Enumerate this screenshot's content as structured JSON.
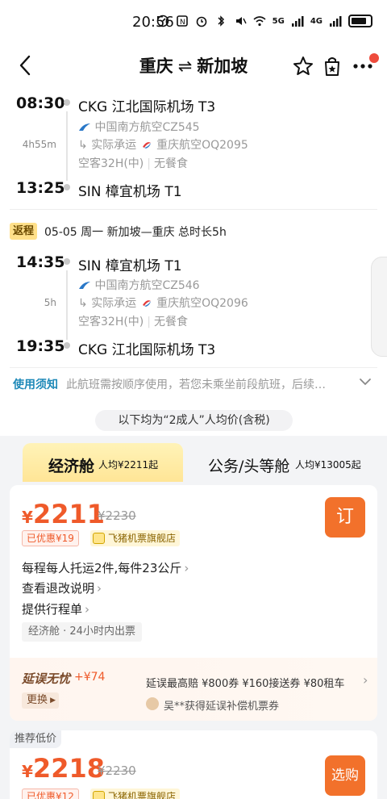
{
  "status_bar": {
    "time": "20:56",
    "network_5g": "5G",
    "network_4g": "4G"
  },
  "header": {
    "origin": "重庆",
    "arrow": "⇌",
    "destination": "新加坡"
  },
  "outbound": {
    "dep_time": "08:30",
    "dep_airport": "CKG 江北国际机场 T3",
    "duration": "4h55m",
    "airline": "中国南方航空CZ545",
    "operated_prefix": "实际承运",
    "operator": "重庆航空OQ2095",
    "aircraft": "空客32H(中)",
    "meal": "无餐食",
    "arr_time": "13:25",
    "arr_airport": "SIN 樟宜机场 T1"
  },
  "return_header": {
    "badge": "返程",
    "info": "05-05  周一  新加坡—重庆  总时长5h"
  },
  "inbound": {
    "dep_time": "14:35",
    "dep_airport": "SIN 樟宜机场 T1",
    "duration": "5h",
    "airline": "中国南方航空CZ546",
    "operated_prefix": "实际承运",
    "operator": "重庆航空OQ2096",
    "aircraft": "空客32H(中)",
    "meal": "无餐食",
    "arr_time": "19:35",
    "arr_airport": "CKG 江北国际机场 T3"
  },
  "notice": {
    "label": "使用须知",
    "text": "此航班需按顺序使用，若您未乘坐前段航班，后续…"
  },
  "price_note": "以下均为“2成人”人均价(含税)",
  "tabs": [
    {
      "label": "经济舱",
      "sub": "人均¥2211起",
      "active": true
    },
    {
      "label": "公务/头等舱",
      "sub": "人均¥13005起",
      "active": false
    }
  ],
  "offer1": {
    "yen": "¥",
    "price": "2211",
    "old_price": "¥2230",
    "book_label": "订",
    "discount": "已优惠¥19",
    "store": "飞猪机票旗舰店",
    "baggage": "每程每人托运2件,每件23公斤",
    "refund": "查看退改说明",
    "itinerary": "提供行程单",
    "cabin_info": "经济舱 · 24小时内出票"
  },
  "delay_protect": {
    "title": "延误无忧",
    "price": "+¥74",
    "change_label": "更换",
    "desc": "延误最高赔 ¥800券  ¥160接送券  ¥80租车",
    "user_line": "吴**获得延误补偿机票券"
  },
  "offer2": {
    "tag": "推荐低价",
    "yen": "¥",
    "price": "2218",
    "old_price": "¥2230",
    "book_label": "选购",
    "discount": "已优惠¥12",
    "store": "飞猪机票旗舰店"
  },
  "colors": {
    "accent": "#ef5a2a",
    "button": "#f2712b",
    "tab_active": "#ffe596",
    "notice_label": "#1e89b8"
  }
}
